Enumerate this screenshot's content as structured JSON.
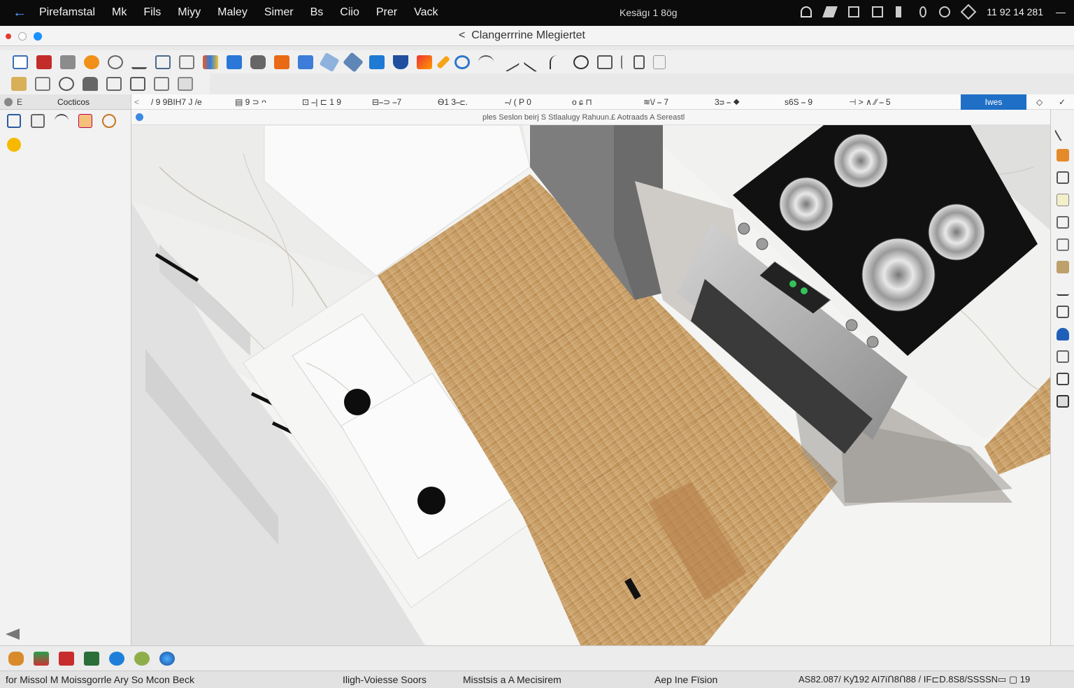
{
  "menubar": {
    "app_name": "Pirefamstal",
    "menus": [
      "Mk",
      "Fils",
      "Miyy",
      "Maley",
      "Simer",
      "Bs",
      "Ciio",
      "Prer",
      "Vack"
    ],
    "center_text": "Kesägı   1 8ög",
    "clock": "11 92 14 281"
  },
  "window": {
    "title": "Clangerrrine Mlegiertet"
  },
  "left_panel": {
    "header_short": "E",
    "header_label": "Cocticos"
  },
  "options_bar": {
    "segments": [
      "/ 9 9BIH7 J /e",
      "▤ 9 ⊃ ᴖ",
      "⊡ ⎯| ⊏ 1 9",
      "⊟⎯⊃ ⎯7",
      "Ѳ1 3⎯⊏.",
      "⎯/ ( P 0",
      "o  ɕ  ⊓",
      "≋\\/ ⎯ 7",
      "3ᴝ ⎯ ◆",
      "s6S ⎯ 9",
      "⊣ > ∧ ⁄⁄ ⎯ 5"
    ],
    "active_button": "Iwes"
  },
  "info_bar": {
    "text": "ples   Seslon beirj S Stlaalugy Rahuun.£ Aotraads A Sereastl"
  },
  "status_bar": {
    "left": "for Missol M Moissgorrle Ary So Mcon Beck",
    "mid1": "Iligh-Voiesse Soors",
    "mid2": "Misstsis a A Mecisirem",
    "mid3": "Aep Ine Fïsion",
    "right": "AS82.087/ Kƴ192 AI7ïᑎ8ᑎ88 / IF⊏D.8S8/SSSSN▭  ▢  19"
  },
  "colors": {
    "accent": "#1f6fc6",
    "menubar_bg": "#0b0b0b",
    "floor_wood": "#c9a16a",
    "marble": "#efefee",
    "cooktop": "#111111"
  }
}
